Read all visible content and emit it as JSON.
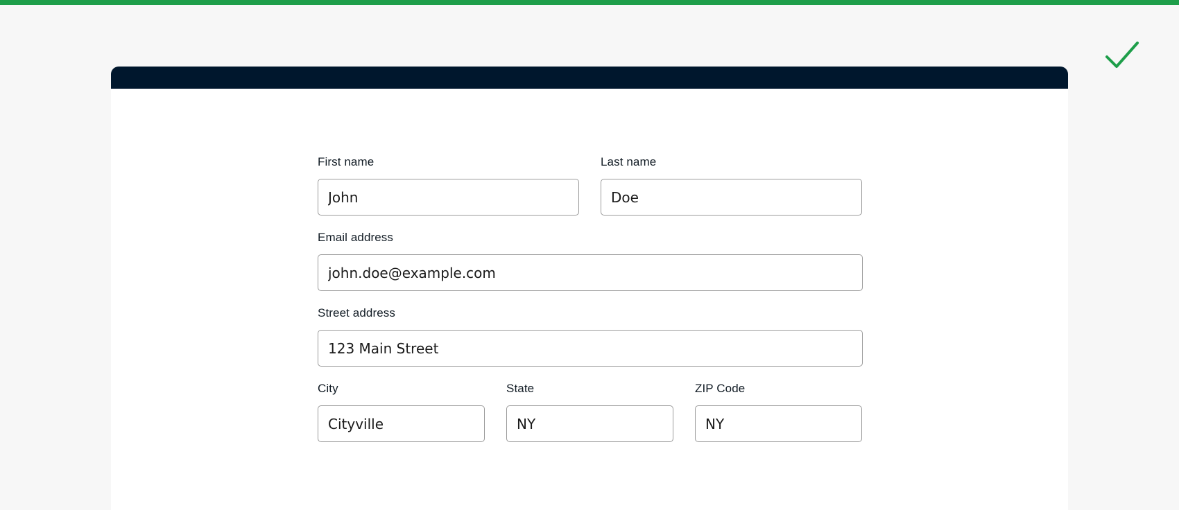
{
  "colors": {
    "accent": "#1e9e4a",
    "header": "#00172d",
    "background": "#f7f7f7"
  },
  "status_icon": "checkmark-icon",
  "form": {
    "first_name": {
      "label": "First name",
      "value": "John"
    },
    "last_name": {
      "label": "Last name",
      "value": "Doe"
    },
    "email": {
      "label": "Email address",
      "value": "john.doe@example.com"
    },
    "street": {
      "label": "Street address",
      "value": "123 Main Street"
    },
    "city": {
      "label": "City",
      "value": "Cityville"
    },
    "state": {
      "label": "State",
      "value": "NY"
    },
    "zip": {
      "label": "ZIP Code",
      "value": "NY"
    }
  }
}
